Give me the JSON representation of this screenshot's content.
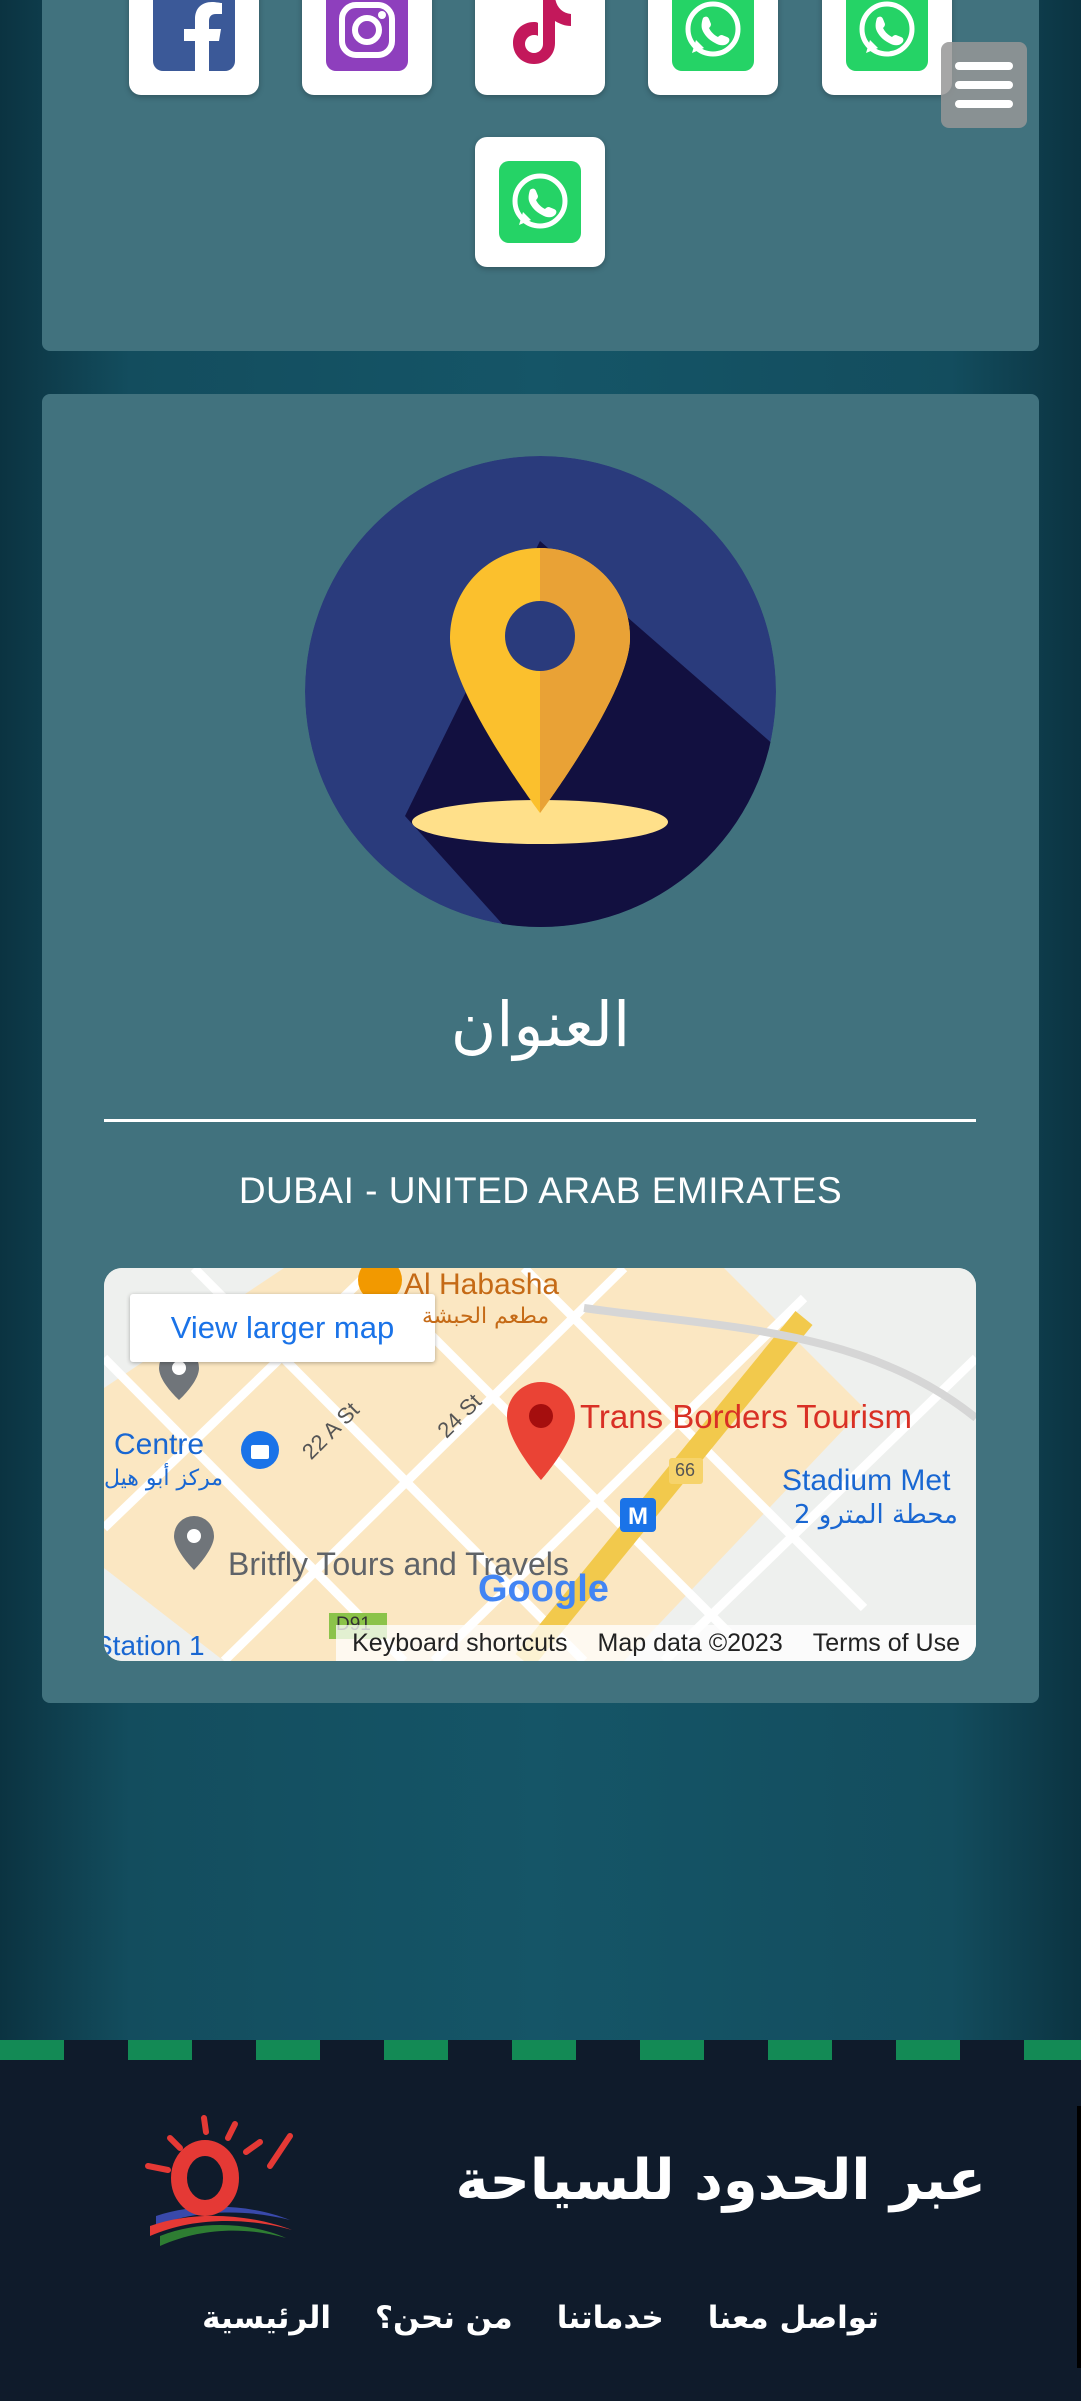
{
  "social_links": [
    {
      "name": "Facebook",
      "icon": "facebook-icon",
      "color": "#3b5998"
    },
    {
      "name": "Instagram",
      "icon": "instagram-icon",
      "color": "#8e3fbd"
    },
    {
      "name": "TikTok",
      "icon": "tiktok-icon",
      "color": "#c3185b"
    },
    {
      "name": "WhatsApp",
      "icon": "whatsapp-icon",
      "color": "#25d366"
    },
    {
      "name": "WhatsApp",
      "icon": "whatsapp-icon",
      "color": "#25d366"
    },
    {
      "name": "WhatsApp",
      "icon": "whatsapp-icon",
      "color": "#25d366"
    }
  ],
  "address": {
    "heading": "العنوان",
    "text": "DUBAI - UNITED ARAB EMIRATES"
  },
  "map": {
    "view_larger": "View larger map",
    "place_name": "Trans Borders Tourism",
    "labels": {
      "al_habasha": "Al Habasha",
      "al_habasha_ar": "مطعم الحبشة",
      "centre": "Centre",
      "centre_ar": "مركز أبو هيل",
      "street_22a": "22 A St",
      "street_24": "24 St",
      "stadium": "Stadium Met",
      "stadium_ar": "محطة المترو 2",
      "britfly": "Britfly Tours and Travels",
      "route_66": "66",
      "d91": "D91",
      "station": "Station 1"
    },
    "google": "Google",
    "footer": {
      "shortcuts": "Keyboard shortcuts",
      "data": "Map data ©2023",
      "terms": "Terms of Use"
    }
  },
  "footer": {
    "brand": "عبر الحدود للسياحة",
    "nav": [
      {
        "label": "تواصل معنا"
      },
      {
        "label": "خدماتنا"
      },
      {
        "label": "من نحن؟"
      },
      {
        "label": "الرئيسية"
      }
    ]
  },
  "colors": {
    "background": "#155567",
    "card": "#41727e",
    "footer": "#0f1b2b",
    "accent_green": "#138a55"
  }
}
